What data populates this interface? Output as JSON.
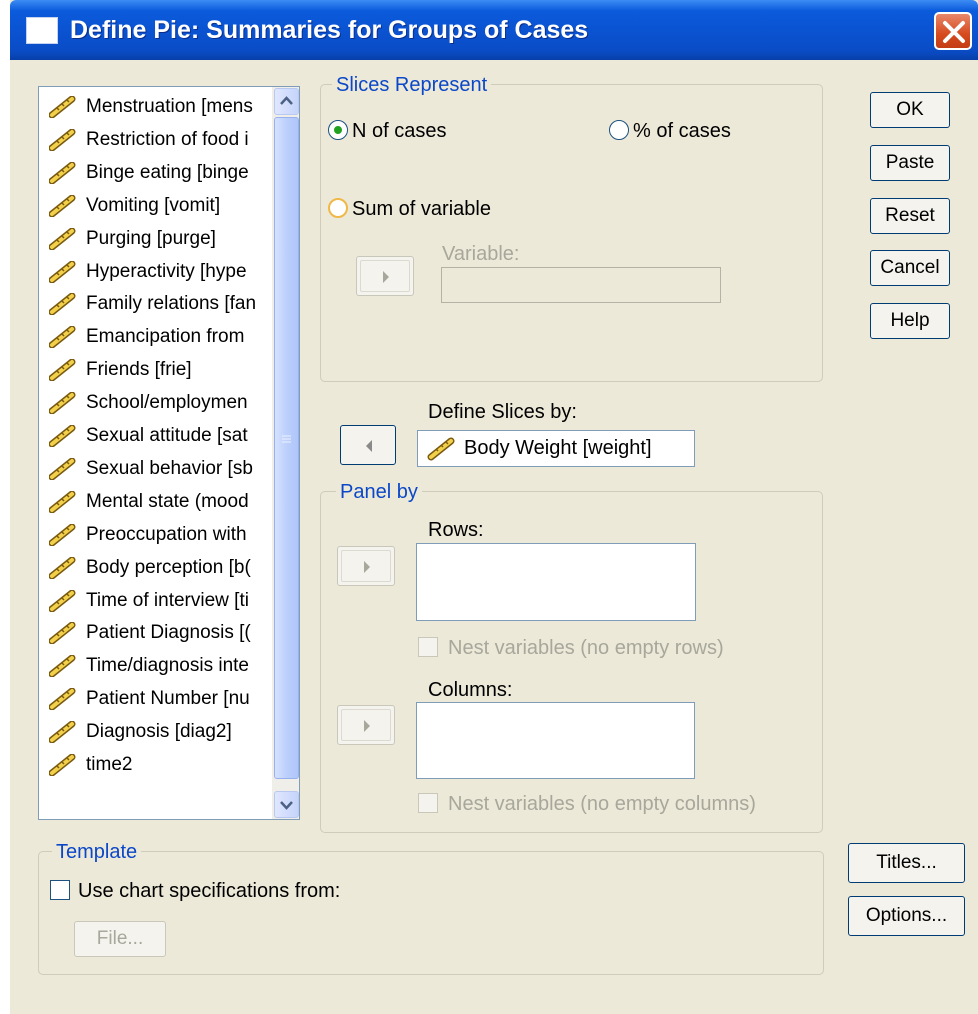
{
  "window": {
    "title": "Define Pie: Summaries for Groups of Cases"
  },
  "variables": [
    "Menstruation [mens",
    "Restriction of food i",
    "Binge eating [binge",
    "Vomiting [vomit]",
    "Purging [purge]",
    "Hyperactivity [hype",
    "Family relations [fan",
    "Emancipation from",
    "Friends [frie]",
    "School/employmen",
    "Sexual attitude [sat",
    "Sexual behavior [sb",
    "Mental state (mood",
    "Preoccupation with",
    "Body perception [b(",
    "Time of interview [ti",
    "Patient Diagnosis [(",
    "Time/diagnosis inte",
    "Patient Number [nu",
    "Diagnosis [diag2]",
    "time2"
  ],
  "slices_represent": {
    "legend": "Slices Represent",
    "n_of_cases": "N of cases",
    "pct_of_cases": "% of cases",
    "sum_of_variable": "Sum of variable",
    "variable_label": "Variable:",
    "variable_value": "",
    "selected": "N of cases"
  },
  "define_slices": {
    "label": "Define Slices by:",
    "value": "Body Weight [weight]"
  },
  "panel_by": {
    "legend": "Panel by",
    "rows_label": "Rows:",
    "nest_rows": "Nest variables (no empty rows)",
    "columns_label": "Columns:",
    "nest_columns": "Nest variables (no empty columns)"
  },
  "template": {
    "legend": "Template",
    "use_spec": "Use chart specifications from:",
    "file_button": "File..."
  },
  "buttons": {
    "ok": "OK",
    "paste": "Paste",
    "reset": "Reset",
    "cancel": "Cancel",
    "help": "Help",
    "titles": "Titles...",
    "options": "Options..."
  },
  "colors": {
    "titlebar": "#0a52d0",
    "dialog_bg": "#ece9d8",
    "group_legend": "#0b47c8",
    "close_button": "#d64a1e"
  }
}
